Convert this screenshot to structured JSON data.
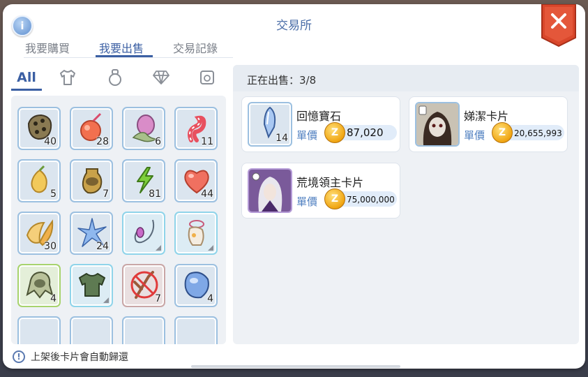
{
  "window": {
    "title": "交易所",
    "info_icon": "info-icon",
    "close_icon": "close-icon"
  },
  "tabs": [
    {
      "label": "我要購買",
      "active": false
    },
    {
      "label": "我要出售",
      "active": true
    },
    {
      "label": "交易記錄",
      "active": false
    }
  ],
  "filters": {
    "all_label": "All",
    "icons": [
      "shirt-icon",
      "potion-icon",
      "gem-icon",
      "card-icon"
    ]
  },
  "inventory": {
    "items": [
      {
        "icon": "rock-shell-icon",
        "qty": "40"
      },
      {
        "icon": "apple-juice-icon",
        "qty": "28"
      },
      {
        "icon": "pink-flower-bud-icon",
        "qty": "6"
      },
      {
        "icon": "candy-cane-icon",
        "qty": "11"
      },
      {
        "icon": "yellow-fruit-icon",
        "qty": "5"
      },
      {
        "icon": "golden-vase-icon",
        "qty": "7"
      },
      {
        "icon": "green-lightning-icon",
        "qty": "81"
      },
      {
        "icon": "red-heart-icon",
        "qty": "44"
      },
      {
        "icon": "golden-petal-icon",
        "qty": "30"
      },
      {
        "icon": "blue-crystal-star-icon",
        "qty": "24"
      },
      {
        "icon": "necklace-icon",
        "qty": ""
      },
      {
        "icon": "cat-costume-icon",
        "qty": ""
      },
      {
        "icon": "green-hood-icon",
        "qty": "4"
      },
      {
        "icon": "green-shirt-icon",
        "qty": ""
      },
      {
        "icon": "forbidden-twig-icon",
        "qty": "7"
      },
      {
        "icon": "blue-gem-icon",
        "qty": "4"
      }
    ]
  },
  "selling": {
    "label": "正在出售：3/8",
    "listings": [
      {
        "name": "回憶寶石",
        "unit_label": "單價",
        "price": "87,020",
        "qty": "14",
        "thumb": "memory-gem-icon"
      },
      {
        "name": "娣潔卡片",
        "unit_label": "單價",
        "price": "20,655,993",
        "qty": "",
        "thumb": "ghost-girl-card-icon"
      },
      {
        "name": "荒境領主卡片",
        "unit_label": "單價",
        "price": "75,000,000",
        "qty": "",
        "thumb": "wasteland-lord-card-icon"
      }
    ],
    "currency_icon": "zeny-coin-icon",
    "currency_glyph": "Z"
  },
  "footer": {
    "note": "上架後卡片會自動歸還",
    "note_icon": "exclamation-icon"
  },
  "colors": {
    "accent": "#3b5fa3",
    "close_red": "#d9472b",
    "zeny_gold": "#f0a512"
  }
}
